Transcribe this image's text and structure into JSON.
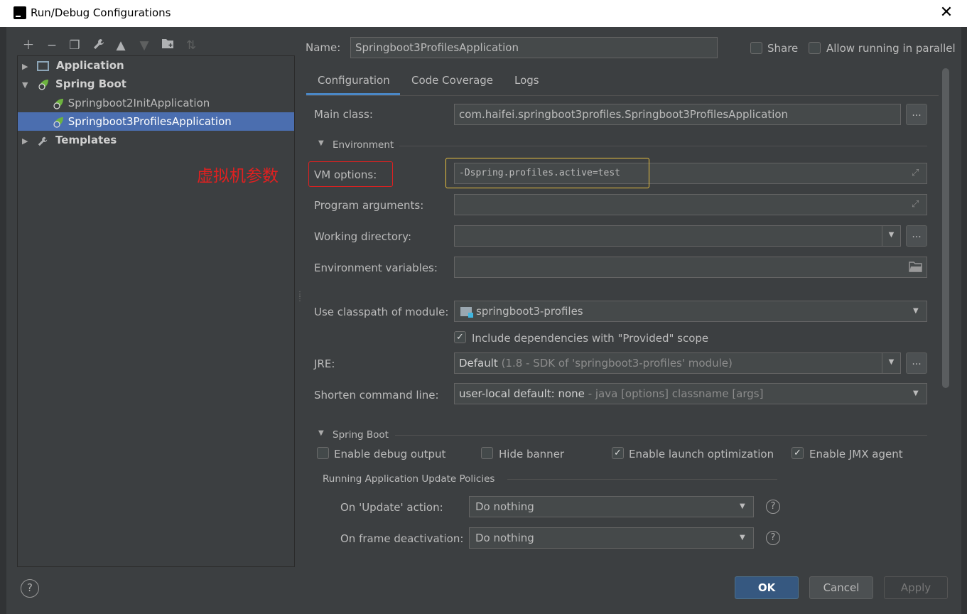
{
  "window": {
    "title": "Run/Debug Configurations"
  },
  "toolbar": {
    "icons": [
      "plus-icon",
      "minus-icon",
      "copy-icon",
      "wrench-icon",
      "arrow-up-icon",
      "arrow-down-icon",
      "folder-add-icon",
      "sort-icon"
    ]
  },
  "tree": {
    "items": [
      {
        "label": "Application",
        "level": 0,
        "expanded": false
      },
      {
        "label": "Spring Boot",
        "level": 0,
        "expanded": true
      },
      {
        "label": "Springboot2InitApplication",
        "level": 1
      },
      {
        "label": "Springboot3ProfilesApplication",
        "level": 1,
        "selected": true
      },
      {
        "label": "Templates",
        "level": 0,
        "expanded": false
      }
    ]
  },
  "annotation": {
    "text": "虚拟机参数"
  },
  "header": {
    "name_label": "Name:",
    "name_value": "Springboot3ProfilesApplication",
    "share_label": "Share",
    "parallel_label": "Allow running in parallel"
  },
  "tabs": [
    "Configuration",
    "Code Coverage",
    "Logs"
  ],
  "config": {
    "main_class_label": "Main class:",
    "main_class_value": "com.haifei.springboot3profiles.Springboot3ProfilesApplication",
    "environment_label": "Environment",
    "vm_options_label": "VM options:",
    "vm_options_value": "-Dspring.profiles.active=test",
    "program_args_label": "Program arguments:",
    "working_dir_label": "Working directory:",
    "env_vars_label": "Environment variables:",
    "classpath_label": "Use classpath of module:",
    "classpath_value": "springboot3-profiles",
    "include_deps_label": "Include dependencies with \"Provided\" scope",
    "include_deps_checked": true,
    "jre_label": "JRE:",
    "jre_value_main": "Default",
    "jre_value_detail": " (1.8 - SDK of 'springboot3-profiles' module)",
    "shorten_label": "Shorten command line:",
    "shorten_value_main": "user-local default: none",
    "shorten_value_detail": " - java [options] classname [args]"
  },
  "spring_boot": {
    "section_label": "Spring Boot",
    "debug_output_label": "Enable debug output",
    "debug_output_checked": false,
    "hide_banner_label": "Hide banner",
    "hide_banner_checked": false,
    "launch_opt_label": "Enable launch optimization",
    "launch_opt_checked": true,
    "jmx_label": "Enable JMX agent",
    "jmx_checked": true,
    "policies_label": "Running Application Update Policies",
    "on_update_label": "On 'Update' action:",
    "on_update_value": "Do nothing",
    "on_frame_label": "On frame deactivation:",
    "on_frame_value": "Do nothing"
  },
  "footer": {
    "ok": "OK",
    "cancel": "Cancel",
    "apply": "Apply"
  },
  "colors": {
    "accent": "#4a88c7",
    "selection": "#4b6eaf",
    "annotation": "#e02020",
    "highlight": "#e8c040"
  }
}
